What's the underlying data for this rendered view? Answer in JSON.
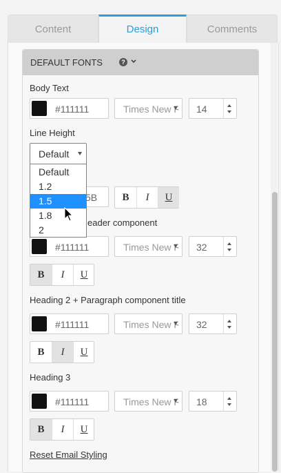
{
  "tabs": [
    {
      "label": "Content"
    },
    {
      "label": "Design"
    },
    {
      "label": "Comments"
    }
  ],
  "panel": {
    "title": "DEFAULT FONTS",
    "help_icon": "question-circle-icon",
    "toggle_icon": "chevron-down-icon"
  },
  "body_text": {
    "label": "Body Text",
    "color": "#111111",
    "font": "Times New Roman",
    "size": "14"
  },
  "line_height": {
    "label": "Line Height",
    "selected": "Default",
    "options": [
      "Default",
      "1.2",
      "1.5",
      "1.8",
      "2"
    ],
    "highlighted": "1.5"
  },
  "hidden_row": {
    "color_partial": "5B"
  },
  "heading1": {
    "label_partial": "eader component",
    "color": "#111111",
    "font": "Times New Roman",
    "size": "32"
  },
  "heading2": {
    "label": "Heading 2 + Paragraph component title",
    "color": "#111111",
    "font": "Times New Roman",
    "size": "32"
  },
  "heading3": {
    "label": "Heading 3",
    "color": "#111111",
    "font": "Times New Roman",
    "size": "18"
  },
  "style_buttons": {
    "bold": "B",
    "italic": "I",
    "underline": "U"
  },
  "reset_label": "Reset Email Styling",
  "colors": {
    "accent": "#2a9fd6",
    "highlight": "#1e90ff",
    "swatch": "#111111"
  }
}
